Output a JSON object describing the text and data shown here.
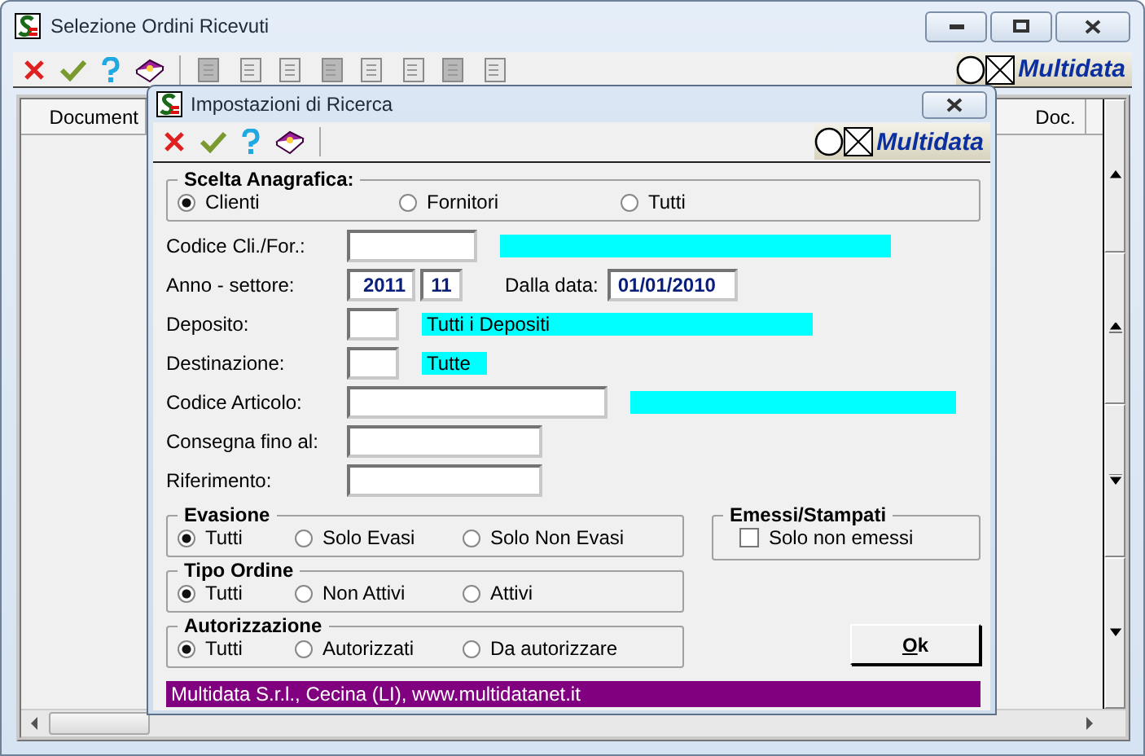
{
  "main_window": {
    "title": "Selezione Ordini Ricevuti",
    "brand": "Multidata",
    "columns": [
      {
        "label": "Document"
      },
      {
        "label": "Doc."
      }
    ]
  },
  "dialog": {
    "title": "Impostazioni di Ricerca",
    "brand": "Multidata",
    "anagrafica": {
      "title": "Scelta Anagrafica:",
      "options": [
        {
          "label": "Clienti",
          "selected": true
        },
        {
          "label": "Fornitori",
          "selected": false
        },
        {
          "label": "Tutti",
          "selected": false
        }
      ]
    },
    "fields": [
      {
        "label": "Codice Cli./For.:",
        "inputs": [
          {
            "kind": "code"
          }
        ],
        "lookup": {
          "kind": "wide"
        }
      },
      {
        "label": "Anno - settore:",
        "inputs": [
          {
            "kind": "year",
            "value": "2011"
          },
          {
            "kind": "sector",
            "value": "11"
          },
          {
            "kind": "date",
            "label": "Dalla data:",
            "value": "01/01/2010"
          }
        ]
      },
      {
        "label": "Deposito:",
        "inputs": [
          {
            "kind": "short"
          }
        ],
        "lookup": {
          "kind": "wide",
          "text": "Tutti i Depositi"
        }
      },
      {
        "label": "Destinazione:",
        "inputs": [
          {
            "kind": "short"
          }
        ],
        "lookup": {
          "kind": "fit",
          "text": "Tutte"
        }
      },
      {
        "label": "Codice Articolo:",
        "inputs": [
          {
            "kind": "long"
          }
        ],
        "lookup": {
          "kind": "medium"
        }
      },
      {
        "label": "Consegna fino al:",
        "inputs": [
          {
            "kind": "medium"
          }
        ]
      },
      {
        "label": "Riferimento:",
        "inputs": [
          {
            "kind": "medium"
          }
        ]
      }
    ],
    "groups": [
      {
        "title": "Evasione",
        "options": [
          {
            "label": "Tutti",
            "selected": true
          },
          {
            "label": "Solo Evasi",
            "selected": false
          },
          {
            "label": "Solo Non Evasi",
            "selected": false
          }
        ]
      },
      {
        "title": "Tipo Ordine",
        "options": [
          {
            "label": "Tutti",
            "selected": true
          },
          {
            "label": "Non Attivi",
            "selected": false
          },
          {
            "label": "Attivi",
            "selected": false
          }
        ]
      },
      {
        "title": "Autorizzazione",
        "options": [
          {
            "label": "Tutti",
            "selected": true
          },
          {
            "label": "Autorizzati",
            "selected": false
          },
          {
            "label": "Da autorizzare",
            "selected": false
          }
        ]
      }
    ],
    "emessi": {
      "title": "Emessi/Stampati",
      "checkbox": {
        "label": "Solo non emessi",
        "checked": false
      }
    },
    "ok_button": "Ok",
    "footer": "Multidata S.r.l., Cecina (LI), www.multidatanet.it"
  }
}
